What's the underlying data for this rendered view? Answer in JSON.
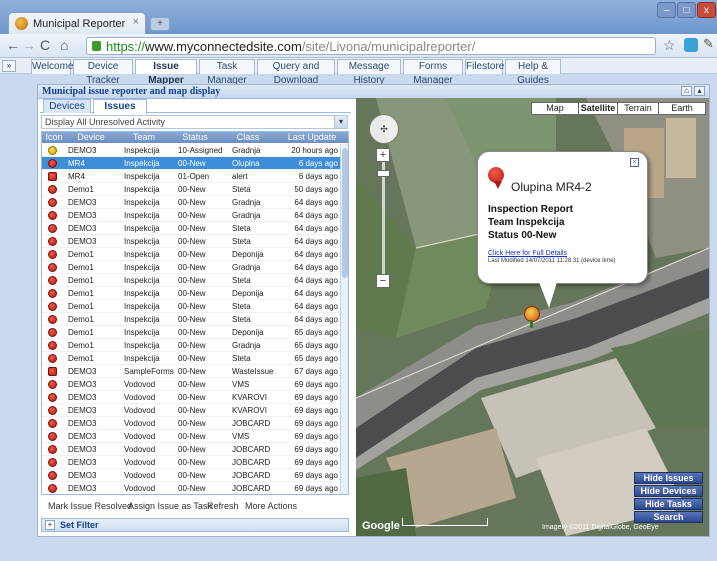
{
  "browser": {
    "tab_title": "Municipal Reporter",
    "tab_close": "×",
    "new_tab": "+",
    "url_scheme": "https://",
    "url_host": "www.myconnectedsite.com",
    "url_path": "/site/Livona/municipalreporter/",
    "min": "–",
    "max": "□",
    "close": "x"
  },
  "app_tabs": [
    "Welcome",
    "Device Tracker",
    "Issue Mapper",
    "Task Manager",
    "Query and Download",
    "Message History",
    "Forms Manager",
    "Filestore",
    "Help & Guides"
  ],
  "active_app_tab": "Issue Mapper",
  "panel": {
    "title": "Municipal issue reporter and map display",
    "sub_tabs": [
      "Devices",
      "Issues"
    ],
    "filter_value": "Display All Unresolved Activity",
    "columns": [
      "Icon",
      "Device",
      "Team",
      "Status",
      "Class",
      "Last Update"
    ],
    "rows": [
      {
        "icon": "yellow",
        "device": "DEMO3",
        "team": "Inspekcija",
        "status": "10-Assigned",
        "class": "Gradnja",
        "last": "20 hours ago"
      },
      {
        "icon": "red",
        "device": "MR4",
        "team": "Inspekcija",
        "status": "00-New",
        "class": "Olupina",
        "last": "6 days ago",
        "selected": true
      },
      {
        "icon": "red-sq",
        "device": "MR4",
        "team": "Inspekcija",
        "status": "01-Open",
        "class": "alert",
        "last": "6 days ago"
      },
      {
        "icon": "red",
        "device": "Demo1",
        "team": "Inspekcija",
        "status": "00-New",
        "class": "Steta",
        "last": "50 days ago"
      },
      {
        "icon": "red",
        "device": "DEMO3",
        "team": "Inspekcija",
        "status": "00-New",
        "class": "Gradnja",
        "last": "64 days ago"
      },
      {
        "icon": "red",
        "device": "DEMO3",
        "team": "Inspekcija",
        "status": "00-New",
        "class": "Gradnja",
        "last": "64 days ago"
      },
      {
        "icon": "red",
        "device": "DEMO3",
        "team": "Inspekcija",
        "status": "00-New",
        "class": "Steta",
        "last": "64 days ago"
      },
      {
        "icon": "red",
        "device": "DEMO3",
        "team": "Inspekcija",
        "status": "00-New",
        "class": "Steta",
        "last": "64 days ago"
      },
      {
        "icon": "red",
        "device": "Demo1",
        "team": "Inspekcija",
        "status": "00-New",
        "class": "Deponija",
        "last": "64 days ago"
      },
      {
        "icon": "red",
        "device": "Demo1",
        "team": "Inspekcija",
        "status": "00-New",
        "class": "Gradnja",
        "last": "64 days ago"
      },
      {
        "icon": "red",
        "device": "Demo1",
        "team": "Inspekcija",
        "status": "00-New",
        "class": "Steta",
        "last": "64 days ago"
      },
      {
        "icon": "red",
        "device": "Demo1",
        "team": "Inspekcija",
        "status": "00-New",
        "class": "Deponija",
        "last": "64 days ago"
      },
      {
        "icon": "red",
        "device": "Demo1",
        "team": "Inspekcija",
        "status": "00-New",
        "class": "Steta",
        "last": "64 days ago"
      },
      {
        "icon": "red",
        "device": "Demo1",
        "team": "Inspekcija",
        "status": "00-New",
        "class": "Steta",
        "last": "64 days ago"
      },
      {
        "icon": "red",
        "device": "Demo1",
        "team": "Inspekcija",
        "status": "00-New",
        "class": "Deponija",
        "last": "65 days ago"
      },
      {
        "icon": "red",
        "device": "Demo1",
        "team": "Inspekcija",
        "status": "00-New",
        "class": "Gradnja",
        "last": "65 days ago"
      },
      {
        "icon": "red",
        "device": "Demo1",
        "team": "Inspekcija",
        "status": "00-New",
        "class": "Steta",
        "last": "65 days ago"
      },
      {
        "icon": "red-sq",
        "device": "DEMO3",
        "team": "SampleForms",
        "status": "00-New",
        "class": "WasteIssue",
        "last": "67 days ago"
      },
      {
        "icon": "red",
        "device": "DEMO3",
        "team": "Vodovod",
        "status": "00-New",
        "class": "VMS",
        "last": "69 days ago"
      },
      {
        "icon": "red",
        "device": "DEMO3",
        "team": "Vodovod",
        "status": "00-New",
        "class": "KVAROVI",
        "last": "69 days ago"
      },
      {
        "icon": "red",
        "device": "DEMO3",
        "team": "Vodovod",
        "status": "00-New",
        "class": "KVAROVI",
        "last": "69 days ago"
      },
      {
        "icon": "red",
        "device": "DEMO3",
        "team": "Vodovod",
        "status": "00-New",
        "class": "JOBCARD",
        "last": "69 days ago"
      },
      {
        "icon": "red",
        "device": "DEMO3",
        "team": "Vodovod",
        "status": "00-New",
        "class": "VMS",
        "last": "69 days ago"
      },
      {
        "icon": "red",
        "device": "DEMO3",
        "team": "Vodovod",
        "status": "00-New",
        "class": "JOBCARD",
        "last": "69 days ago"
      },
      {
        "icon": "red",
        "device": "DEMO3",
        "team": "Vodovod",
        "status": "00-New",
        "class": "JOBCARD",
        "last": "69 days ago"
      },
      {
        "icon": "red",
        "device": "DEMO3",
        "team": "Vodovod",
        "status": "00-New",
        "class": "JOBCARD",
        "last": "69 days ago"
      },
      {
        "icon": "red",
        "device": "DEMO3",
        "team": "Vodovod",
        "status": "00-New",
        "class": "JOBCARD",
        "last": "69 days ago"
      }
    ],
    "actions": [
      "Mark Issue Resolved",
      "Assign Issue as Task",
      "Refresh",
      "More Actions"
    ],
    "set_filter": "Set Filter"
  },
  "map": {
    "types": [
      "Map",
      "Satellite",
      "Terrain",
      "Earth"
    ],
    "active_type": "Satellite",
    "popup": {
      "title": "Olupina MR4-2",
      "line1": "Inspection Report",
      "line2": "Team  Inspekcija",
      "line3": "Status 00-New",
      "link": "Click Here for Full Details",
      "modified": "Last Modified 14/07/2011 11:28:31 (device time)"
    },
    "buttons": [
      "Hide Issues",
      "Hide Devices",
      "Hide Tasks",
      "Search"
    ],
    "google": "Google",
    "imagery": "Imagery ©2011 DigitalGlobe, GeoEye"
  }
}
